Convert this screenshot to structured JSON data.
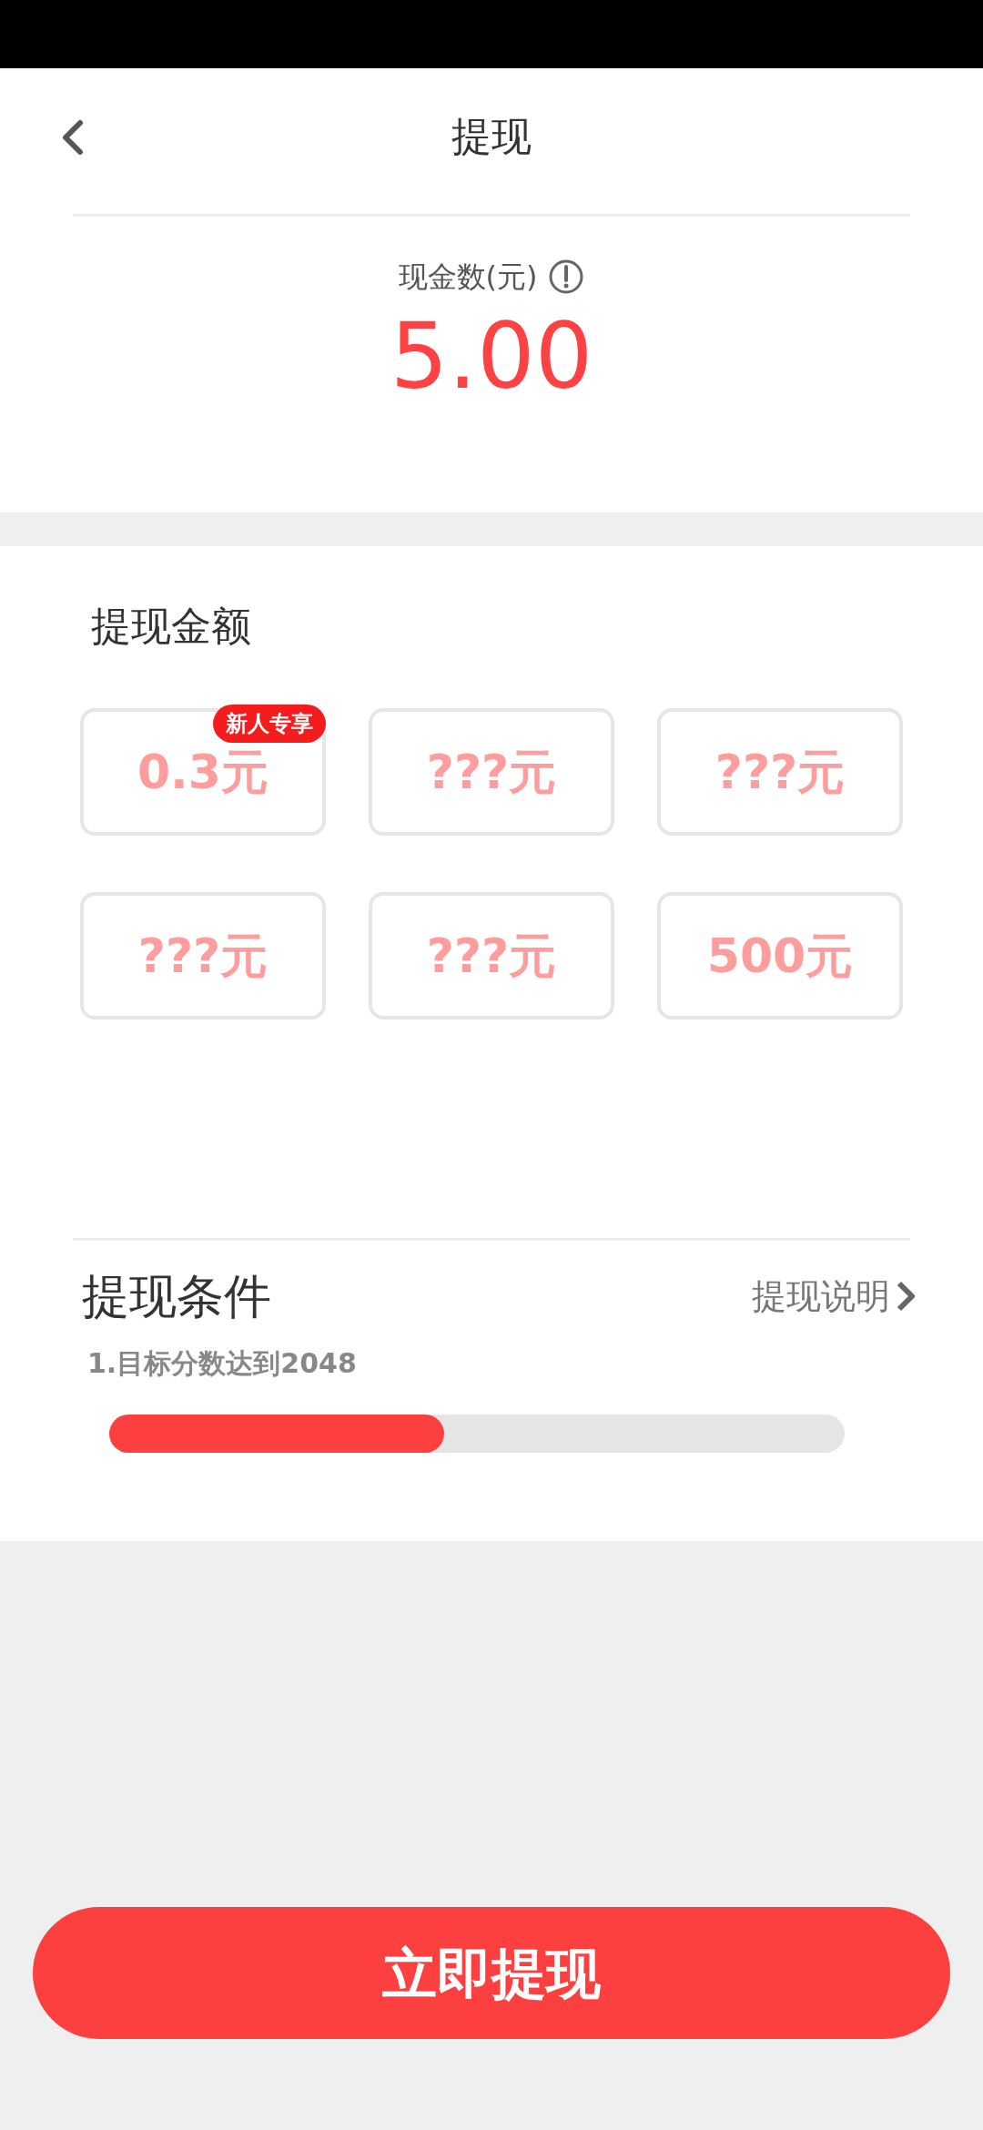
{
  "header": {
    "title": "提现"
  },
  "balance": {
    "label": "现金数(元)",
    "amount": "5.00"
  },
  "amounts": {
    "title": "提现金额",
    "options": [
      {
        "label": "0.3元",
        "badge": "新人专享"
      },
      {
        "label": "???元"
      },
      {
        "label": "???元"
      },
      {
        "label": "???元"
      },
      {
        "label": "???元"
      },
      {
        "label": "500元"
      }
    ]
  },
  "conditions": {
    "title": "提现条件",
    "link": "提现说明",
    "items": [
      {
        "text": "1.目标分数达到2048",
        "level": 0.455
      }
    ]
  },
  "submit_button": "立即提现"
}
